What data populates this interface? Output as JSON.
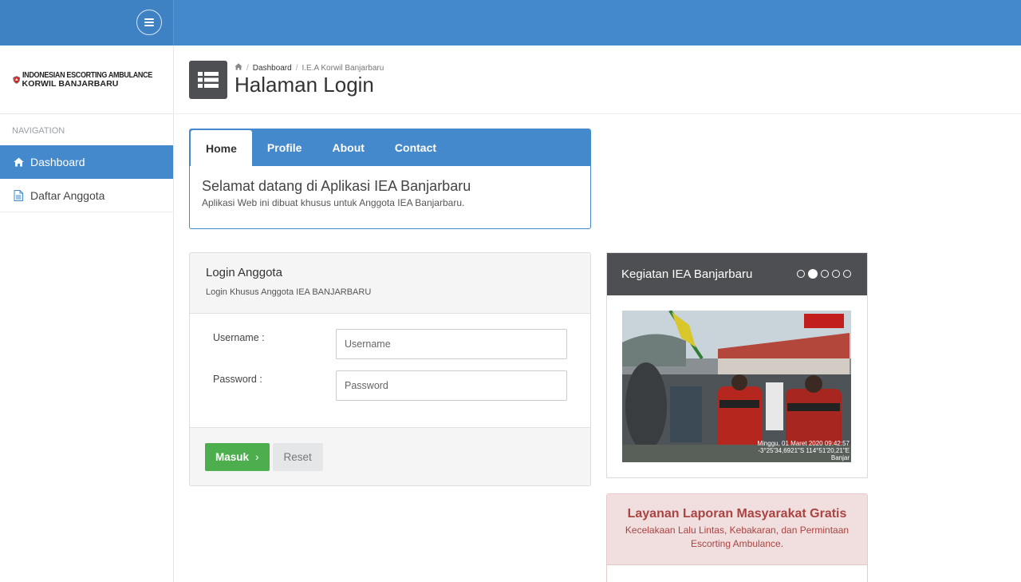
{
  "topbar": {
    "menu_toggle": "menu-icon"
  },
  "brand": {
    "line1": "INDONESIAN ESCORTING AMBULANCE",
    "line2": "KORWIL BANJARBARU"
  },
  "sidebar": {
    "header": "NAVIGATION",
    "items": [
      {
        "label": "Dashboard",
        "icon": "home-icon",
        "active": true
      },
      {
        "label": "Daftar Anggota",
        "icon": "document-icon",
        "active": false
      }
    ]
  },
  "breadcrumb": {
    "items": [
      "Dashboard",
      "I.E.A Korwil Banjarbaru"
    ]
  },
  "page": {
    "title": "Halaman Login"
  },
  "tabs": {
    "items": [
      "Home",
      "Profile",
      "About",
      "Contact"
    ],
    "active": "Home",
    "content_title": "Selamat datang di Aplikasi IEA Banjarbaru",
    "content_text": "Aplikasi Web ini dibuat khusus untuk Anggota IEA Banjarbaru."
  },
  "login": {
    "title": "Login Anggota",
    "subtitle": "Login Khusus Anggota IEA BANJARBARU",
    "username_label": "Username :",
    "username_placeholder": "Username",
    "password_label": "Password :",
    "password_placeholder": "Password",
    "submit_label": "Masuk",
    "reset_label": "Reset"
  },
  "activity": {
    "title": "Kegiatan IEA Banjarbaru",
    "slide_count": 5,
    "active_slide": 2,
    "photo_stamp": [
      "Minggu, 01 Maret 2020 09:42:57",
      "-3°25'34,6921\"S 114°51'20,21\"E",
      "Banjar"
    ]
  },
  "alert": {
    "title": "Layanan Laporan Masyarakat Gratis",
    "text": "Kecelakaan Lalu Lintas, Kebakaran, dan Permintaan Escorting Ambulance."
  },
  "colors": {
    "primary": "#4389cc",
    "dark": "#4d4f52",
    "success": "#4cae4c",
    "danger_text": "#a94442",
    "danger_bg": "#f1dede"
  }
}
